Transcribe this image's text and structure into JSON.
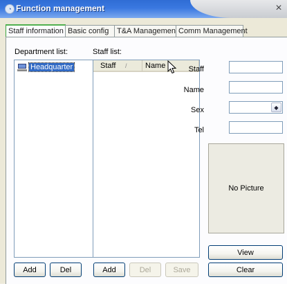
{
  "window": {
    "title": "Function management",
    "close_glyph": "×"
  },
  "tabs": [
    {
      "label": "Staff information",
      "active": true
    },
    {
      "label": "Basic config",
      "active": false
    },
    {
      "label": "T&A Management",
      "active": false
    },
    {
      "label": "Comm Management",
      "active": false
    }
  ],
  "department": {
    "label": "Department list:",
    "items": [
      {
        "label": "Headquarter",
        "icon": "computer-icon",
        "selected": true
      }
    ],
    "add_label": "Add",
    "del_label": "Del"
  },
  "staff": {
    "label": "Staff list:",
    "columns": [
      {
        "label": "Staff",
        "sort_indicator": "/"
      },
      {
        "label": "Name"
      }
    ],
    "rows": [],
    "add_label": "Add",
    "del_label": "Del",
    "save_label": "Save"
  },
  "details": {
    "staff_label": "Staff",
    "staff_value": "",
    "name_label": "Name",
    "name_value": "",
    "sex_label": "Sex",
    "sex_value": "",
    "tel_label": "Tel",
    "tel_value": "",
    "picture_text": "No Picture",
    "view_label": "View",
    "clear_label": "Clear"
  },
  "colors": {
    "title_bar": "#3a78e0",
    "selection": "#316ac5",
    "active_tab_accent": "#51b04f"
  }
}
